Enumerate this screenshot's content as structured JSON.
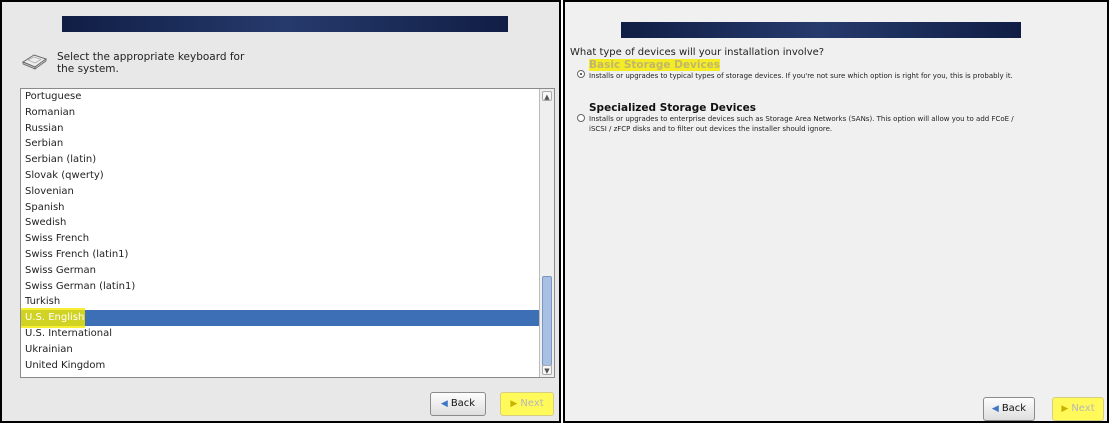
{
  "left": {
    "prompt": "Select the appropriate keyboard for the system.",
    "layouts": [
      "Portuguese",
      "Romanian",
      "Russian",
      "Serbian",
      "Serbian (latin)",
      "Slovak (qwerty)",
      "Slovenian",
      "Spanish",
      "Swedish",
      "Swiss French",
      "Swiss French (latin1)",
      "Swiss German",
      "Swiss German (latin1)",
      "Turkish",
      "U.S. English",
      "U.S. International",
      "Ukrainian",
      "United Kingdom"
    ],
    "selected_index": 14,
    "back_label": "Back",
    "next_label": "Next"
  },
  "right": {
    "question": "What type of devices will your installation involve?",
    "options": [
      {
        "title": "Basic Storage Devices",
        "description": "Installs or upgrades to typical types of storage devices. If you're not sure which option is right for you, this is probably it.",
        "selected": true
      },
      {
        "title": "Specialized Storage Devices",
        "description": "Installs or upgrades to enterprise devices such as Storage Area Networks (SANs). This option will allow you to add FCoE / iSCSI / zFCP disks and to filter out devices the installer should ignore.",
        "selected": false
      }
    ],
    "back_label": "Back",
    "next_label": "Next"
  },
  "colors": {
    "selection": "#3d6fb6",
    "highlight": "#f5eb00",
    "banner": "#1b2b5a"
  }
}
